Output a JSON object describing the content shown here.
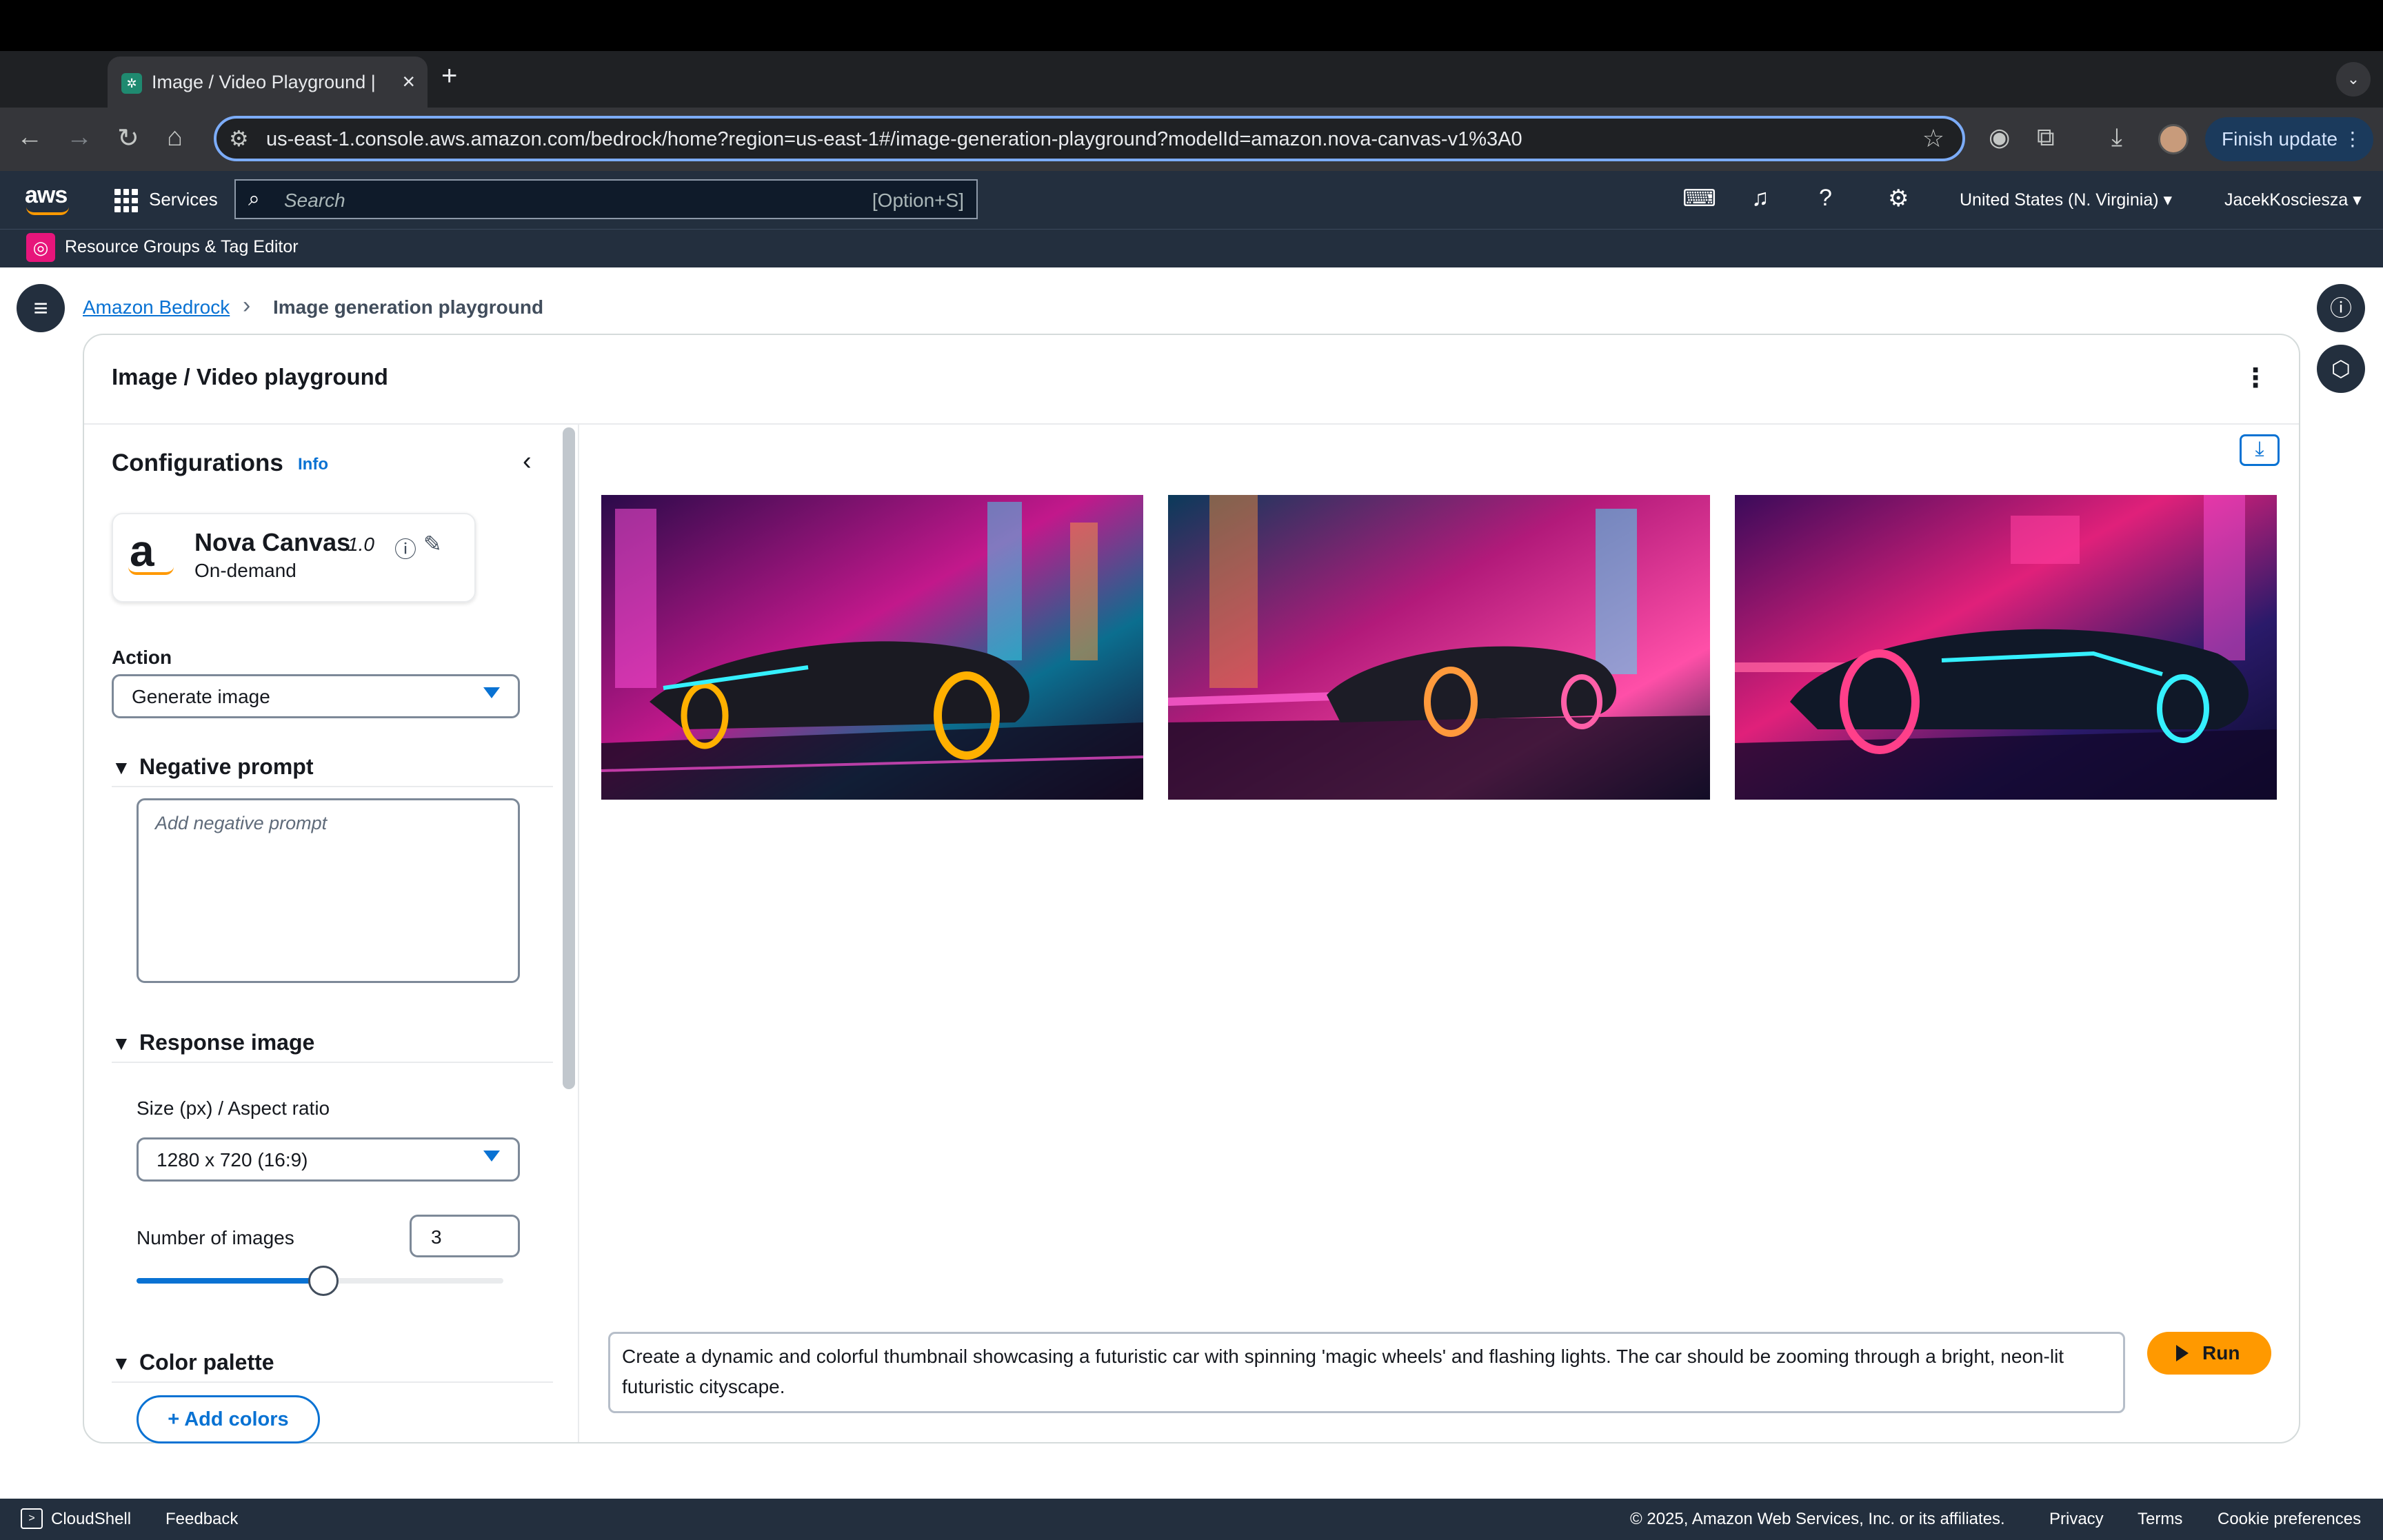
{
  "browser": {
    "tab_title": "Image / Video Playground | Amazon Bedrock",
    "url": "us-east-1.console.aws.amazon.com/bedrock/home?region=us-east-1#/image-generation-playground?modelId=amazon.nova-canvas-v1%3A0",
    "finish_update": "Finish update"
  },
  "aws_header": {
    "logo": "aws",
    "services": "Services",
    "search_placeholder": "Search",
    "search_shortcut": "[Option+S]",
    "region": "United States (N. Virginia)",
    "user": "JacekKoscieszа",
    "resource_groups": "Resource Groups & Tag Editor"
  },
  "breadcrumb": {
    "root": "Amazon Bedrock",
    "current": "Image generation playground"
  },
  "card": {
    "title": "Image / Video playground"
  },
  "config": {
    "title": "Configurations",
    "info": "Info",
    "model": {
      "logo": "a",
      "name": "Nova Canvas",
      "version": "1.0",
      "mode": "On-demand"
    },
    "action_label": "Action",
    "action_value": "Generate image",
    "negative_prompt_title": "Negative prompt",
    "negative_prompt_placeholder": "Add negative prompt",
    "response_image_title": "Response image",
    "size_label": "Size (px) / Aspect ratio",
    "size_value": "1280 x 720 (16:9)",
    "num_images_label": "Number of images",
    "num_images_value": "3",
    "num_images_slider_fraction": 0.51,
    "color_palette_title": "Color palette",
    "add_colors": "Add colors"
  },
  "prompt": {
    "text": "Create a dynamic and colorful thumbnail showcasing a futuristic car with spinning 'magic wheels' and flashing lights. The car should be zooming through a bright, neon-lit futuristic cityscape.",
    "run": "Run"
  },
  "footer": {
    "cloudshell": "CloudShell",
    "feedback": "Feedback",
    "copyright": "© 2025, Amazon Web Services, Inc. or its affiliates.",
    "privacy": "Privacy",
    "terms": "Terms",
    "cookies": "Cookie preferences"
  },
  "colors": {
    "aws_nav": "#232f3e",
    "link": "#0972d3",
    "run_button": "#ff9900"
  }
}
